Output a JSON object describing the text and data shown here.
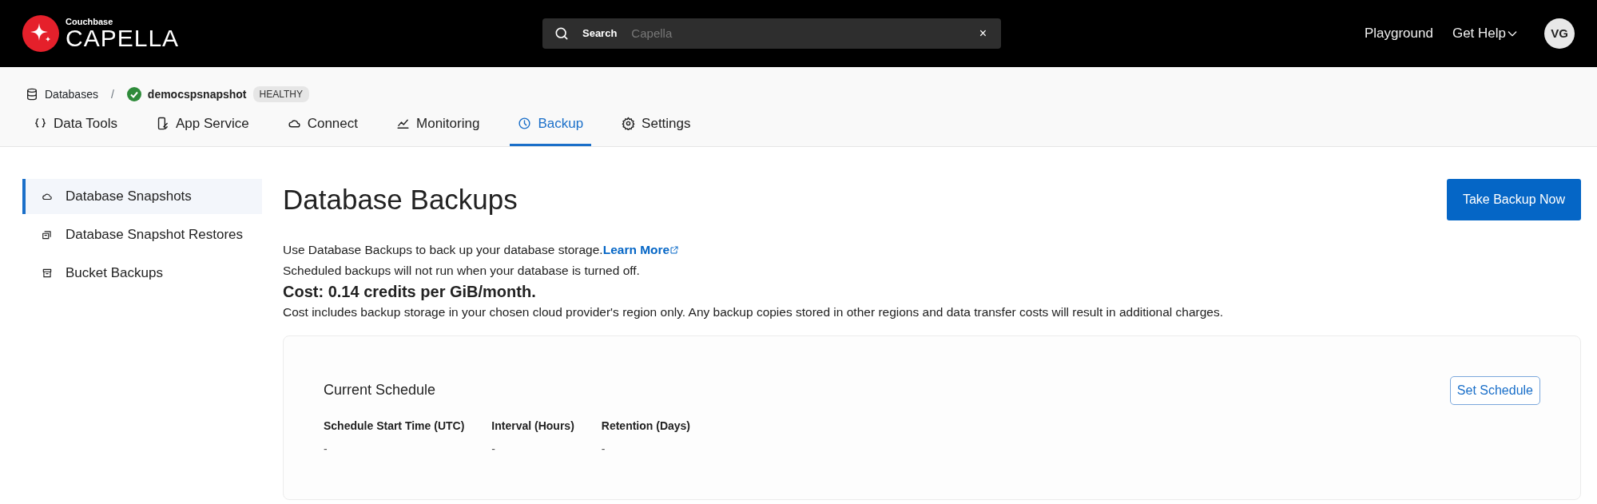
{
  "header": {
    "logo_top": "Couchbase",
    "logo_main": "CAPELLA",
    "search": {
      "label": "Search",
      "placeholder": "Capella",
      "clear": "×"
    },
    "links": [
      "Playground",
      "Get Help"
    ],
    "avatar": "VG"
  },
  "breadcrumb": {
    "root": "Databases",
    "separator": "/",
    "database": "democspsnapshot",
    "status": "HEALTHY"
  },
  "tabs": [
    {
      "label": "Data Tools",
      "selected": false
    },
    {
      "label": "App Service",
      "selected": false
    },
    {
      "label": "Connect",
      "selected": false
    },
    {
      "label": "Monitoring",
      "selected": false
    },
    {
      "label": "Backup",
      "selected": true
    },
    {
      "label": "Settings",
      "selected": false
    }
  ],
  "sidebar": {
    "items": [
      {
        "label": "Database Snapshots",
        "selected": true
      },
      {
        "label": "Database Snapshot Restores",
        "selected": false
      },
      {
        "label": "Bucket Backups",
        "selected": false
      }
    ]
  },
  "main": {
    "title": "Database Backups",
    "primary_button": "Take Backup Now",
    "intro": "Use Database Backups to back up your database storage.",
    "learn_more": "Learn More",
    "note": "Scheduled backups will not run when your database is turned off.",
    "cost": "Cost: 0.14 credits per GiB/month.",
    "cost_note": "Cost includes backup storage in your chosen cloud provider's region only. Any backup copies stored in other regions and data transfer costs will result in additional charges.",
    "schedule": {
      "title": "Current Schedule",
      "button": "Set Schedule",
      "fields": [
        {
          "label": "Schedule Start Time (UTC)",
          "value": "-"
        },
        {
          "label": "Interval (Hours)",
          "value": "-"
        },
        {
          "label": "Retention (Days)",
          "value": "-"
        }
      ]
    }
  }
}
